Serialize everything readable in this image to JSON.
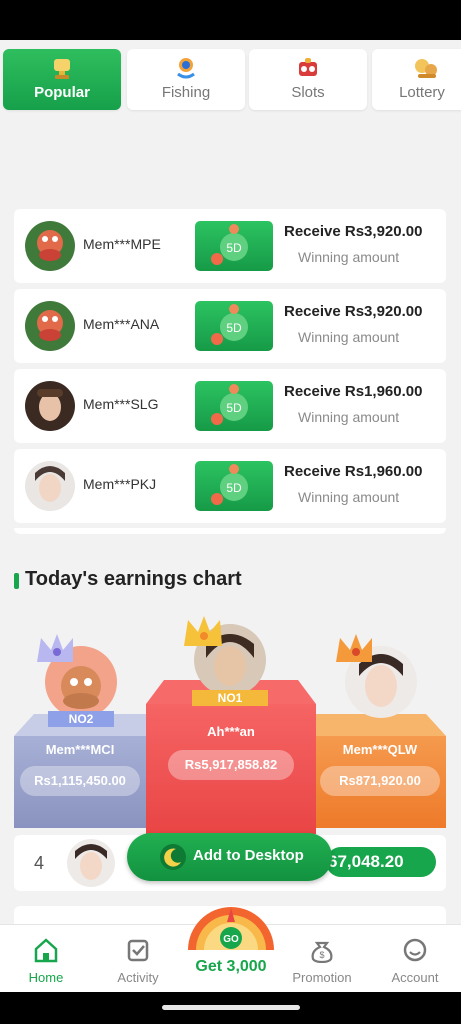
{
  "tabs": [
    {
      "label": "Popular",
      "active": true
    },
    {
      "label": "Fishing",
      "active": false
    },
    {
      "label": "Slots",
      "active": false
    },
    {
      "label": "Lottery",
      "active": false
    }
  ],
  "winners": [
    {
      "name": "Mem***MPE",
      "amount": "Receive Rs3,920.00",
      "sub": "Winning amount",
      "avatar": "cartoon-avatar"
    },
    {
      "name": "Mem***ANA",
      "amount": "Receive Rs3,920.00",
      "sub": "Winning amount",
      "avatar": "cartoon-avatar"
    },
    {
      "name": "Mem***SLG",
      "amount": "Receive Rs1,960.00",
      "sub": "Winning amount",
      "avatar": "woman-avatar"
    },
    {
      "name": "Mem***PKJ",
      "amount": "Receive Rs1,960.00",
      "sub": "Winning amount",
      "avatar": "woman-avatar"
    }
  ],
  "chart": {
    "title": "Today's earnings chart",
    "first": {
      "rank": "NO1",
      "name": "Ah***an",
      "amount": "Rs5,917,858.82"
    },
    "second": {
      "rank": "NO2",
      "name": "Mem***MCI",
      "amount": "Rs1,115,450.00"
    },
    "third": {
      "name": "Mem***QLW",
      "amount": "Rs871,920.00"
    }
  },
  "rank_row": {
    "rank": "4",
    "amount": "67,048.20"
  },
  "desktop_button": {
    "label": "Add to Desktop"
  },
  "nav": {
    "home": "Home",
    "activity": "Activity",
    "get": "Get 3,000",
    "promotion": "Promotion",
    "account": "Account"
  },
  "colors": {
    "accent": "#17a64b",
    "podium_first": "#ef4a4a",
    "podium_second": "#9aa4cc",
    "podium_third": "#f08a3a"
  }
}
